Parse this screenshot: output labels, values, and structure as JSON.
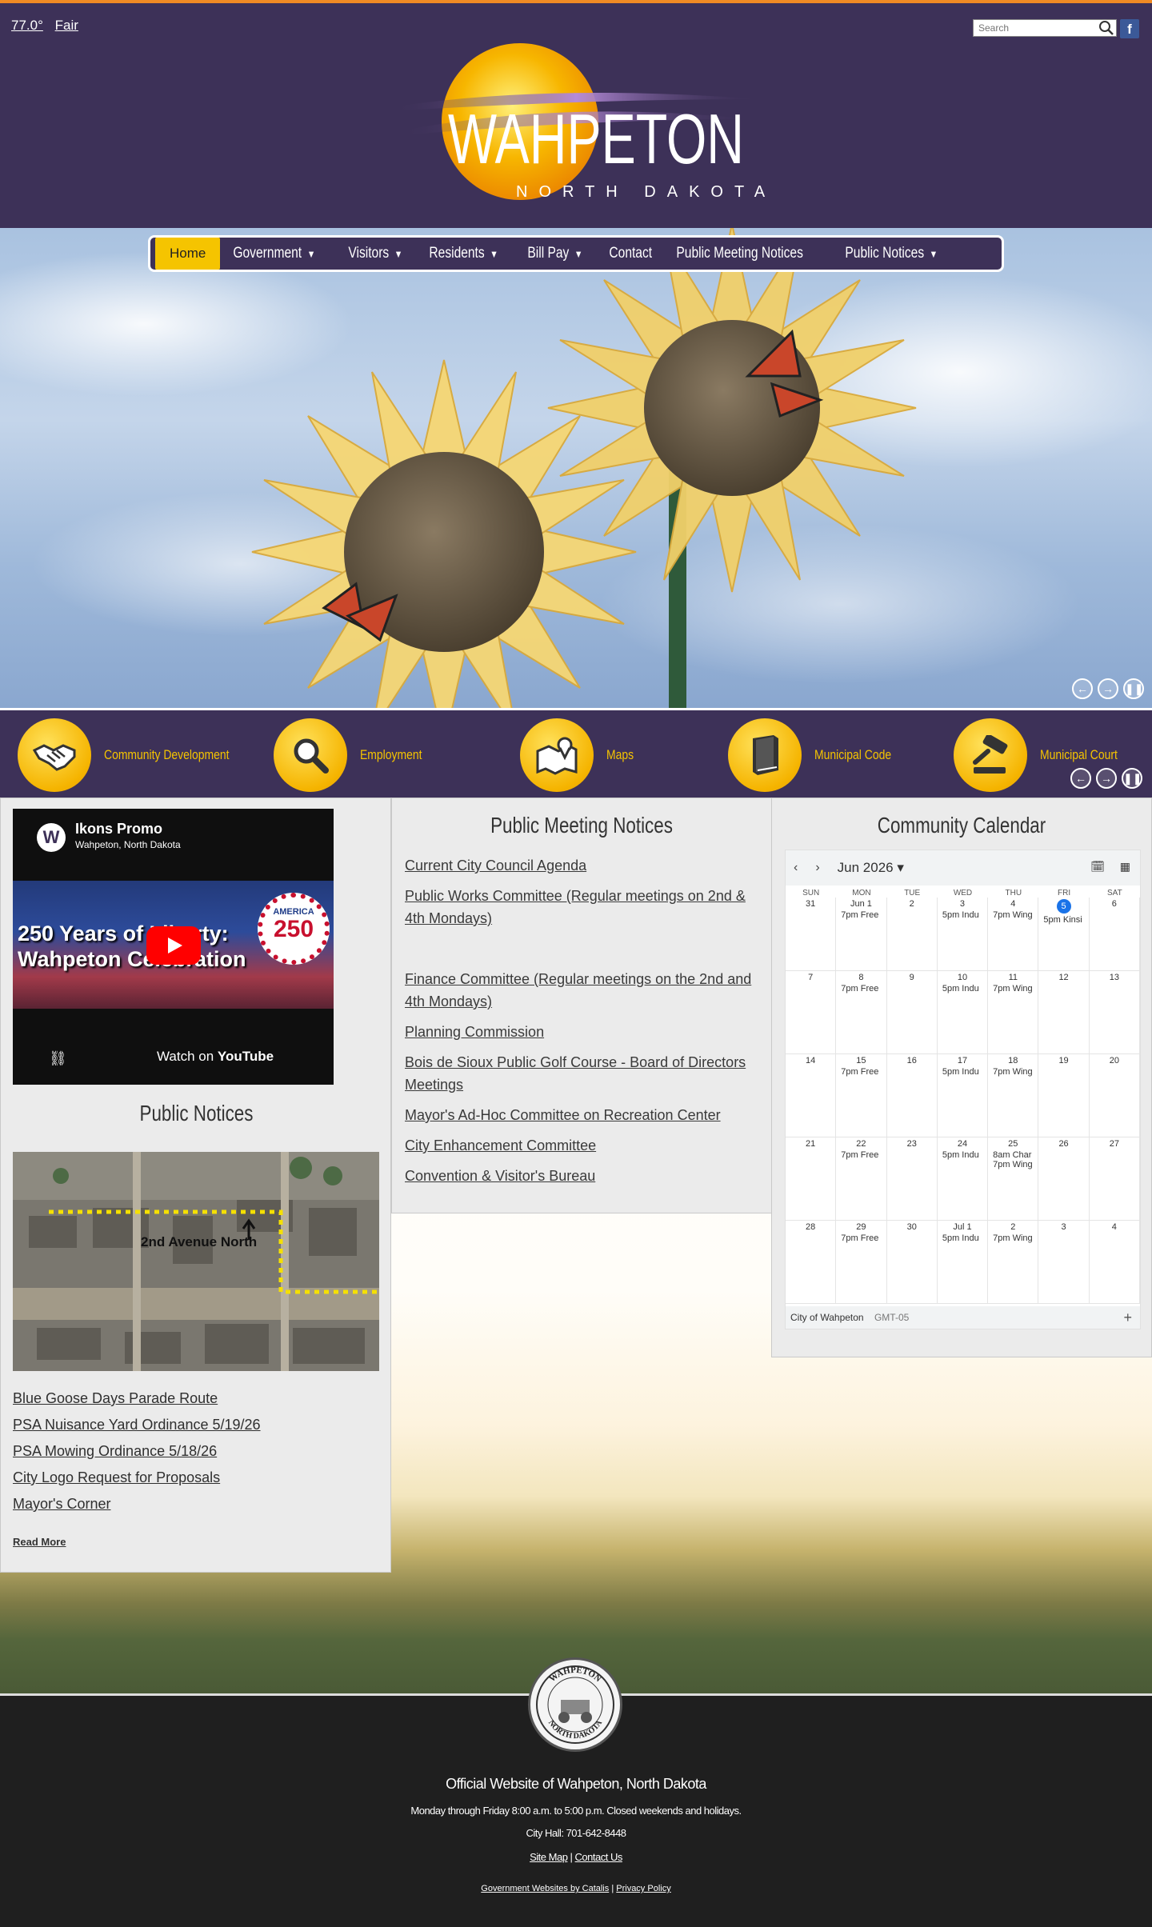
{
  "header": {
    "weather_temp": "77.0°",
    "weather_cond": "Fair",
    "search_placeholder": "Search",
    "logo_name": "WAHPETON",
    "logo_state": "NORTH DAKOTA"
  },
  "nav": {
    "items": [
      {
        "label": "Home"
      },
      {
        "label": "Government"
      },
      {
        "label": "Visitors"
      },
      {
        "label": "Residents"
      },
      {
        "label": "Bill Pay"
      },
      {
        "label": "Contact"
      },
      {
        "label": "Public Meeting Notices"
      },
      {
        "label": "Public Notices"
      }
    ],
    "arrow": "▼"
  },
  "quick_links": [
    {
      "label": "Community Development",
      "icon": "handshake-icon"
    },
    {
      "label": "Employment",
      "icon": "magnifier-icon"
    },
    {
      "label": "Maps",
      "icon": "map-icon"
    },
    {
      "label": "Municipal Code",
      "icon": "book-icon"
    },
    {
      "label": "Municipal Court",
      "icon": "gavel-icon"
    }
  ],
  "video": {
    "channel_initial": "W",
    "title": "Ikons Promo",
    "subtitle": "Wahpeton, North Dakota",
    "thumb_text_1": "250 Years of Liberty:",
    "thumb_text_2": "Wahpeton Celebration",
    "badge_top": "AMERICA",
    "badge_num": "250",
    "watch_on": "Watch on",
    "platform": "YouTube"
  },
  "public_notices": {
    "title": "Public Notices",
    "map_label": "2nd Avenue North",
    "links": [
      "Blue Goose Days Parade Route",
      "PSA Nuisance Yard Ordinance 5/19/26",
      "PSA Mowing Ordinance 5/18/26",
      "City Logo Request for Proposals",
      "Mayor's Corner"
    ],
    "read_more": "Read More"
  },
  "public_meeting": {
    "title": "Public Meeting Notices",
    "links": [
      "Current City Council Agenda",
      "Public Works Committee (Regular meetings on 2nd & 4th Mondays)",
      "Finance Committee (Regular meetings on the 2nd and 4th Mondays)",
      "Planning Commission",
      "Bois de Sioux Public Golf Course - Board of Directors Meetings",
      "Mayor's Ad-Hoc Committee on Recreation Center",
      "City Enhancement Committee",
      "Convention & Visitor's Bureau"
    ]
  },
  "calendar": {
    "title": "Community Calendar",
    "month": "Jun 2026",
    "dows": [
      "SUN",
      "MON",
      "TUE",
      "WED",
      "THU",
      "FRI",
      "SAT"
    ],
    "weeks": [
      [
        {
          "d": "31",
          "ev": []
        },
        {
          "d": "Jun 1",
          "ev": [
            "7pm Free"
          ]
        },
        {
          "d": "2",
          "ev": []
        },
        {
          "d": "3",
          "ev": [
            "5pm Indu"
          ]
        },
        {
          "d": "4",
          "ev": [
            "7pm Wing"
          ]
        },
        {
          "d": "5",
          "ev": [
            "5pm Kinsi"
          ],
          "today": true
        },
        {
          "d": "6",
          "ev": []
        }
      ],
      [
        {
          "d": "7",
          "ev": []
        },
        {
          "d": "8",
          "ev": [
            "7pm Free"
          ]
        },
        {
          "d": "9",
          "ev": []
        },
        {
          "d": "10",
          "ev": [
            "5pm Indu"
          ]
        },
        {
          "d": "11",
          "ev": [
            "7pm Wing"
          ]
        },
        {
          "d": "12",
          "ev": []
        },
        {
          "d": "13",
          "ev": []
        }
      ],
      [
        {
          "d": "14",
          "ev": []
        },
        {
          "d": "15",
          "ev": [
            "7pm Free"
          ]
        },
        {
          "d": "16",
          "ev": []
        },
        {
          "d": "17",
          "ev": [
            "5pm Indu"
          ]
        },
        {
          "d": "18",
          "ev": [
            "7pm Wing"
          ]
        },
        {
          "d": "19",
          "ev": []
        },
        {
          "d": "20",
          "ev": []
        }
      ],
      [
        {
          "d": "21",
          "ev": []
        },
        {
          "d": "22",
          "ev": [
            "7pm Free"
          ]
        },
        {
          "d": "23",
          "ev": []
        },
        {
          "d": "24",
          "ev": [
            "5pm Indu"
          ]
        },
        {
          "d": "25",
          "ev": [
            "8am Char",
            "7pm Wing"
          ]
        },
        {
          "d": "26",
          "ev": []
        },
        {
          "d": "27",
          "ev": []
        }
      ],
      [
        {
          "d": "28",
          "ev": []
        },
        {
          "d": "29",
          "ev": [
            "7pm Free"
          ]
        },
        {
          "d": "30",
          "ev": []
        },
        {
          "d": "Jul 1",
          "ev": [
            "5pm Indu"
          ]
        },
        {
          "d": "2",
          "ev": [
            "7pm Wing"
          ]
        },
        {
          "d": "3",
          "ev": []
        },
        {
          "d": "4",
          "ev": []
        }
      ]
    ],
    "footer_name": "City of Wahpeton",
    "footer_tz": "GMT-05"
  },
  "footer": {
    "seal_top": "WAHPETON",
    "seal_bottom": "NORTH DAKOTA",
    "title": "Official Website of Wahpeton, North Dakota",
    "hours": "Monday through Friday 8:00 a.m. to 5:00 p.m. Closed weekends and holidays.",
    "phone": "City Hall: 701-642-8448",
    "site_map": "Site Map",
    "contact_us": "Contact Us",
    "credit": "Government Websites by Catalis",
    "privacy": "Privacy Policy"
  },
  "colors": {
    "brand_purple": "#3d3158",
    "brand_yellow": "#f5c400",
    "accent_orange": "#f08a24"
  }
}
